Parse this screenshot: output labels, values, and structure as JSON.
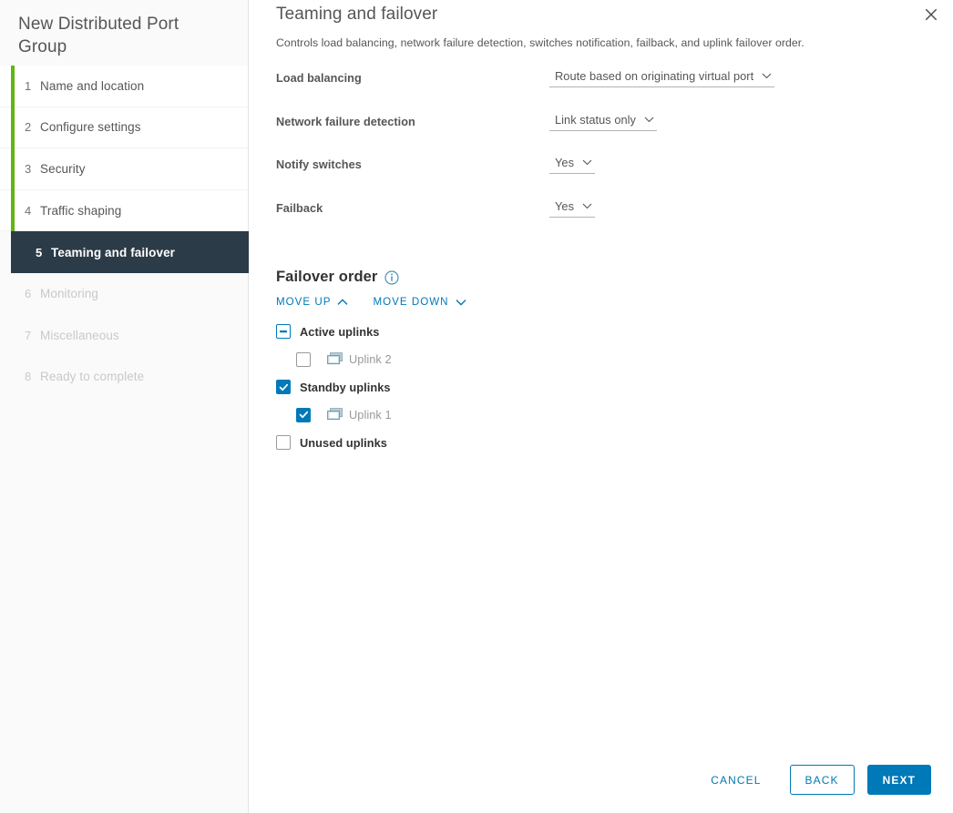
{
  "window": {
    "title": "New Distributed Port Group",
    "close_icon": "close-icon"
  },
  "sidebar": {
    "steps": [
      {
        "num": "1",
        "label": "Name and location",
        "state": "done"
      },
      {
        "num": "2",
        "label": "Configure settings",
        "state": "done"
      },
      {
        "num": "3",
        "label": "Security",
        "state": "done"
      },
      {
        "num": "4",
        "label": "Traffic shaping",
        "state": "done"
      },
      {
        "num": "5",
        "label": "Teaming and failover",
        "state": "selected"
      },
      {
        "num": "6",
        "label": "Monitoring",
        "state": "future"
      },
      {
        "num": "7",
        "label": "Miscellaneous",
        "state": "future"
      },
      {
        "num": "8",
        "label": "Ready to complete",
        "state": "future"
      }
    ],
    "progress_color": "#60b515",
    "selected_color": "#2b3b47"
  },
  "page": {
    "title": "Teaming and failover",
    "subtitle": "Controls load balancing, network failure detection, switches notification, failback, and uplink failover order."
  },
  "form": {
    "fields": [
      {
        "label": "Load balancing",
        "value": "Route based on originating virtual port",
        "icon": "chevron-down-icon"
      },
      {
        "label": "Network failure detection",
        "value": "Link status only",
        "icon": "chevron-down-icon"
      },
      {
        "label": "Notify switches",
        "value": "Yes",
        "icon": "chevron-down-icon"
      },
      {
        "label": "Failback",
        "value": "Yes",
        "icon": "chevron-down-icon"
      }
    ]
  },
  "failover": {
    "heading": "Failover order",
    "info_icon": "info-icon",
    "move_up": {
      "label": "Move up",
      "icon": "chevron-up-icon"
    },
    "move_down": {
      "label": "Move down",
      "icon": "chevron-down-icon"
    },
    "groups": [
      {
        "label": "Active uplinks",
        "checkbox_state": "indeterminate",
        "uplinks": [
          {
            "label": "Uplink 2",
            "checkbox_state": "unchecked",
            "icon": "network-adapter-icon"
          }
        ]
      },
      {
        "label": "Standby uplinks",
        "checkbox_state": "checked",
        "uplinks": [
          {
            "label": "Uplink 1",
            "checkbox_state": "checked",
            "icon": "network-adapter-icon"
          }
        ]
      },
      {
        "label": "Unused uplinks",
        "checkbox_state": "unchecked",
        "uplinks": []
      }
    ]
  },
  "footer": {
    "cancel": "Cancel",
    "back": "Back",
    "next": "Next"
  },
  "colors": {
    "accent": "#0079b8",
    "progress": "#60b515",
    "selected_step": "#2b3b47",
    "text": "#565656",
    "muted": "#9a9a9a"
  }
}
